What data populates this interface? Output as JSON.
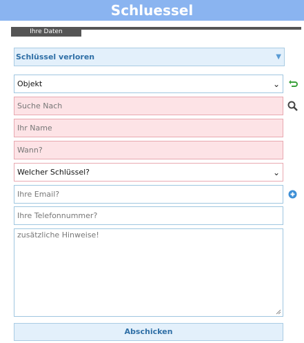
{
  "app": {
    "title": "Schluessel"
  },
  "tabs": {
    "active_label": "Ihre Daten"
  },
  "section": {
    "title": "Schlüssel verloren"
  },
  "form": {
    "objekt_select": {
      "selected": "Objekt"
    },
    "suche_nach": {
      "placeholder": "Suche Nach"
    },
    "ihr_name": {
      "placeholder": "Ihr Name"
    },
    "wann": {
      "placeholder": "Wann?"
    },
    "schluessel_select": {
      "selected": "Welcher Schlüssel?"
    },
    "email": {
      "placeholder": "Ihre Email?"
    },
    "telefon": {
      "placeholder": "Ihre Telefonnummer?"
    },
    "hinweise": {
      "placeholder": "zusätzliche Hinweise!"
    },
    "submit_label": "Abschicken"
  },
  "icons": {
    "refresh": "refresh-icon",
    "search": "search-icon",
    "add": "plus-icon"
  },
  "colors": {
    "header_bg": "#8ab4f0",
    "accent_text": "#2f6fa6",
    "required_bg": "#fde3e6",
    "panel_bg": "#e3f0fb"
  }
}
